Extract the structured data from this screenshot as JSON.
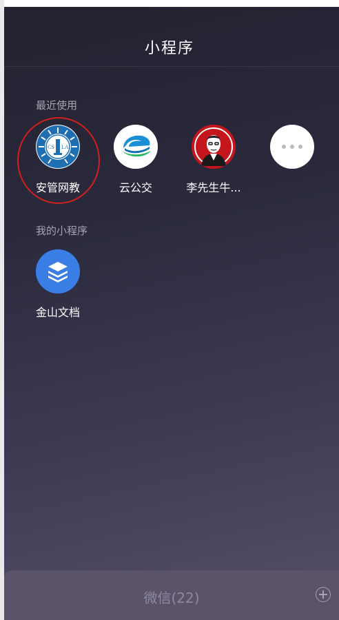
{
  "header": {
    "title": "小程序"
  },
  "sections": {
    "recent": {
      "label": "最近使用"
    },
    "mine": {
      "label": "我的小程序"
    }
  },
  "apps": {
    "anguan": {
      "label": "安管网教",
      "logo_text": "CS LA",
      "icon": "anguan-logo-icon"
    },
    "yungongjiao": {
      "label": "云公交",
      "icon": "bus-swoosh-icon"
    },
    "li": {
      "label": "李先生牛...",
      "icon": "portrait-logo-icon"
    },
    "more": {
      "icon": "more-dots-icon"
    },
    "jinshan": {
      "label": "金山文档",
      "icon": "stacked-layers-icon"
    }
  },
  "bottom_bar": {
    "title": "微信(22)",
    "icon": "add-circle-icon"
  },
  "colors": {
    "highlight": "#d2201e",
    "anguan_blue": "#1d6fb1",
    "yungongjiao_blue": "#1a8fd8",
    "li_red": "#c5161d",
    "jinshan_blue": "#3a7ee6"
  }
}
